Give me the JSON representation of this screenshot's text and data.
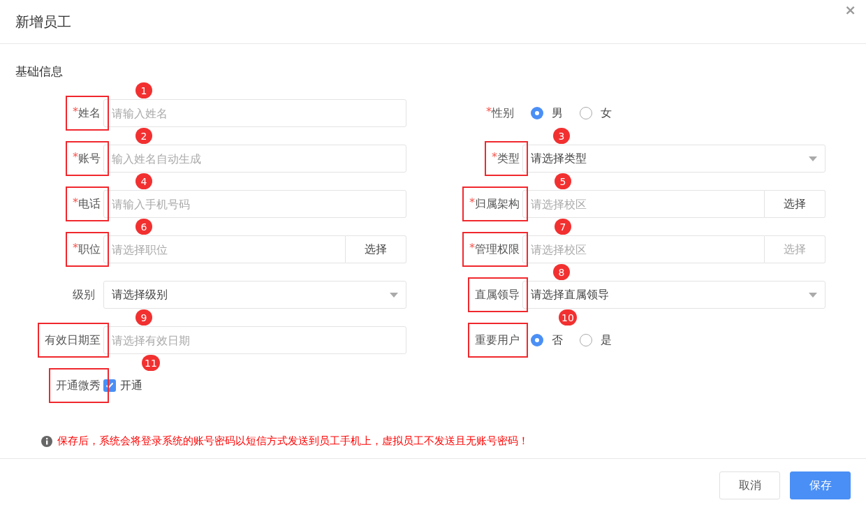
{
  "dialog": {
    "title": "新增员工",
    "close": "×"
  },
  "section": {
    "title": "基础信息"
  },
  "rows": [
    {
      "cells": [
        {
          "kind": "text",
          "label": "姓名",
          "required_mark": "*",
          "annotated": true,
          "badge": "1",
          "placeholder": "请输入姓名"
        },
        {
          "kind": "radio",
          "label": "性别",
          "required_mark": "*",
          "annotated": false,
          "options": [
            {
              "label": "男",
              "selected": true
            },
            {
              "label": "女",
              "selected": false
            }
          ]
        }
      ]
    },
    {
      "cells": [
        {
          "kind": "text",
          "label": "账号",
          "required_mark": "*",
          "annotated": true,
          "badge": "2",
          "placeholder": "输入姓名自动生成"
        },
        {
          "kind": "select",
          "label": "类型",
          "required_mark": "*",
          "annotated": true,
          "badge": "3",
          "placeholder": "请选择类型"
        }
      ]
    },
    {
      "cells": [
        {
          "kind": "text",
          "label": "电话",
          "required_mark": "*",
          "annotated": true,
          "badge": "4",
          "placeholder": "请输入手机号码"
        },
        {
          "kind": "picker",
          "label": "归属架构",
          "required_mark": "*",
          "annotated": true,
          "badge": "5",
          "placeholder": "请选择校区",
          "button": {
            "label": "选择",
            "disabled": false
          }
        }
      ]
    },
    {
      "cells": [
        {
          "kind": "picker",
          "label": "职位",
          "required_mark": "*",
          "annotated": true,
          "badge": "6",
          "placeholder": "请选择职位",
          "button": {
            "label": "选择",
            "disabled": false
          }
        },
        {
          "kind": "picker",
          "label": "管理权限",
          "required_mark": "*",
          "annotated": true,
          "badge": "7",
          "placeholder": "请选择校区",
          "button": {
            "label": "选择",
            "disabled": true
          }
        }
      ]
    },
    {
      "cells": [
        {
          "kind": "select",
          "label": "级别",
          "annotated": false,
          "placeholder": "请选择级别"
        },
        {
          "kind": "select",
          "label": "直属领导",
          "annotated": true,
          "badge": "8",
          "placeholder": "请选择直属领导"
        }
      ]
    },
    {
      "cells": [
        {
          "kind": "text",
          "label": "有效日期至",
          "annotated": true,
          "badge": "9",
          "placeholder": "请选择有效日期"
        },
        {
          "kind": "radio",
          "label": "重要用户",
          "annotated": true,
          "badge": "10",
          "options": [
            {
              "label": "否",
              "selected": true
            },
            {
              "label": "是",
              "selected": false
            }
          ]
        }
      ]
    },
    {
      "cells": [
        {
          "kind": "checkbox",
          "label": "开通微秀",
          "annotated": true,
          "badge": "11",
          "option": {
            "label": "开通",
            "checked": true
          }
        }
      ]
    }
  ],
  "notice": "保存后，系统会将登录系统的账号密码以短信方式发送到员工手机上，虚拟员工不发送且无账号密码！",
  "buttons": [
    {
      "label": "取消",
      "kind": "default"
    },
    {
      "label": "保存",
      "kind": "primary"
    }
  ]
}
